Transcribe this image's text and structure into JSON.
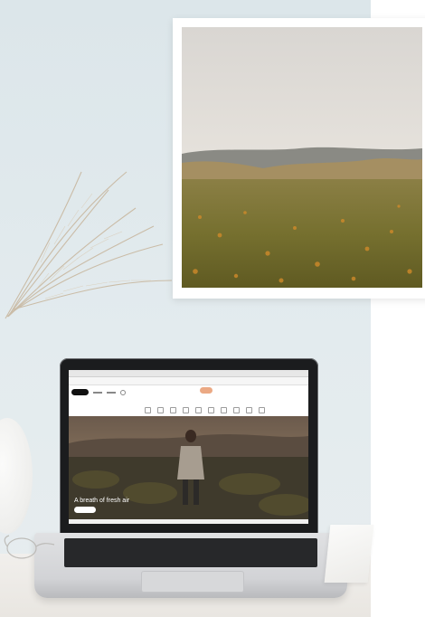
{
  "scene": {
    "subject": "laptop and framed landscape print on a desk",
    "laptop_screen": {
      "hero_title": "A breath of fresh air"
    },
    "colors": {
      "wall": "#e1e9ec",
      "desk": "#eeebe7",
      "laptop_lid": "#1b1c1e",
      "sky": "#dddad6",
      "field": "#6f6a2a",
      "poppies": "#d08a2a"
    },
    "icons": [
      "pampas-grass",
      "vase",
      "glasses",
      "notebook"
    ]
  }
}
